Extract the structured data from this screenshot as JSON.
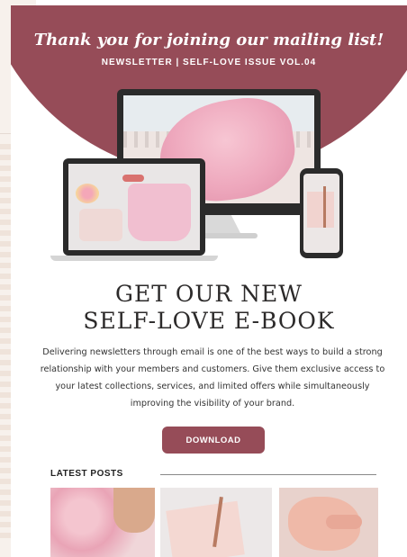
{
  "header": {
    "title": "Thank you for joining our mailing list!",
    "subtitle": "NEWSLETTER | SELF-LOVE ISSUE VOL.04"
  },
  "hero": {
    "heading_line1": "GET OUR NEW",
    "heading_line2": "SELF-LOVE E-BOOK",
    "body": "Delivering newsletters through email is one of the best ways to build a strong relationship with your members and customers. Give them exclusive access to your latest collections, services, and limited offers while simultaneously improving the visibility of your brand.",
    "button_label": "DOWNLOAD"
  },
  "latest_posts": {
    "title": "LATEST POSTS",
    "posts": [
      {
        "image": "pink-dress-photo"
      },
      {
        "image": "notebook-pen-photo"
      },
      {
        "image": "baby-hand-photo"
      }
    ]
  },
  "colors": {
    "brand": "#964c58",
    "background": "#ffffff",
    "text": "#2c2a2a"
  }
}
